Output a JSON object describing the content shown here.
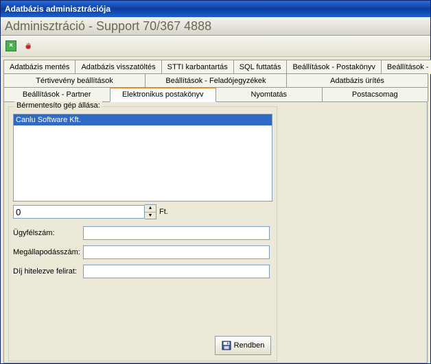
{
  "window": {
    "title": "Adatbázis adminisztrációja"
  },
  "subheader": {
    "text": "Adminisztráció - Support 70/367 4888"
  },
  "toolbar": {
    "btn1_glyph": "×",
    "btn2_glyph": "✋"
  },
  "tabs": {
    "row1": [
      "Adatbázis mentés",
      "Adatbázis visszatöltés",
      "STTI karbantartás",
      "SQL futtatás",
      "Beállítások - Postakönyv",
      "Beállítások - Iktatás"
    ],
    "row2": [
      "Tértivevény beállítások",
      "Beállítások - Feladójegyzékek",
      "Adatbázis ürítés"
    ],
    "row3": [
      "Beállítások - Partner",
      "Elektronikus postakönyv",
      "Nyomtatás",
      "Postacsomag"
    ],
    "active": "Elektronikus postakönyv"
  },
  "group": {
    "label": "Bérmentesíto gép állása:",
    "list_item": "Canlu Software Kft.",
    "num_value": "0",
    "unit": "Ft.",
    "field1_label": "Ügyfélszám:",
    "field1_value": "",
    "field2_label": "Megállapodásszám:",
    "field2_value": "",
    "field3_label": "Díj hitelezve felirat:",
    "field3_value": ""
  },
  "buttons": {
    "ok": "Rendben"
  }
}
